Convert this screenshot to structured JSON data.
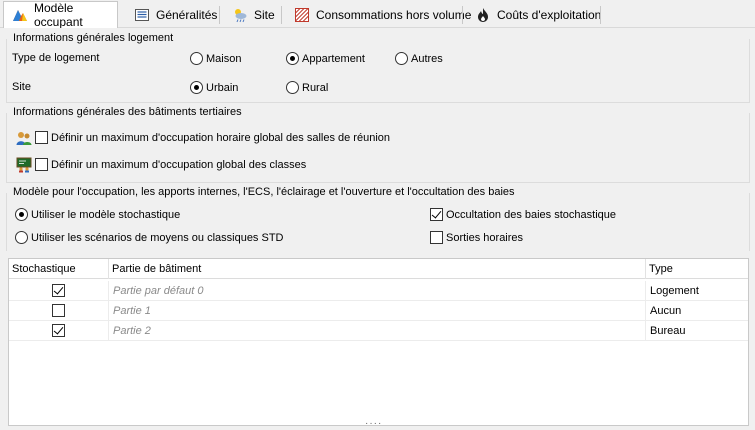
{
  "tabs": [
    {
      "label": "Modèle occupant",
      "icon": "occupant-chart-icon",
      "active": true
    },
    {
      "label": "Généralités",
      "icon": "list-icon",
      "active": false
    },
    {
      "label": "Site",
      "icon": "weather-icon",
      "active": false
    },
    {
      "label": "Consommations hors volume",
      "icon": "hatch-icon",
      "active": false
    },
    {
      "label": "Coûts d'exploitation",
      "icon": "flame-icon",
      "active": false
    }
  ],
  "logement": {
    "title": "Informations générales logement",
    "type_label": "Type de logement",
    "type_options": [
      "Maison",
      "Appartement",
      "Autres"
    ],
    "type_selected": "Appartement",
    "site_label": "Site",
    "site_options": [
      "Urbain",
      "Rural"
    ],
    "site_selected": "Urbain"
  },
  "tertiaire": {
    "title": "Informations générales des bâtiments tertiaires",
    "reunion_label": "Définir un maximum d'occupation horaire global des salles de réunion",
    "classes_label": "Définir un maximum d'occupation global des classes"
  },
  "modele": {
    "title": "Modèle pour l'occupation, les apports internes, l'ECS, l'éclairage et l'ouverture et l'occultation des baies",
    "stochastique_label": "Utiliser le modèle stochastique",
    "scenarios_label": "Utiliser les scénarios de moyens ou classiques STD",
    "occultation_label": "Occultation des baies stochastique",
    "sorties_label": "Sorties horaires"
  },
  "table": {
    "headers": [
      "Stochastique",
      "Partie de bâtiment",
      "Type"
    ],
    "rows": [
      {
        "stochastique": true,
        "partie": "Partie par défaut 0",
        "type": "Logement"
      },
      {
        "stochastique": false,
        "partie": "Partie 1",
        "type": "Aucun"
      },
      {
        "stochastique": true,
        "partie": "Partie 2",
        "type": "Bureau"
      }
    ]
  },
  "grip": "····"
}
